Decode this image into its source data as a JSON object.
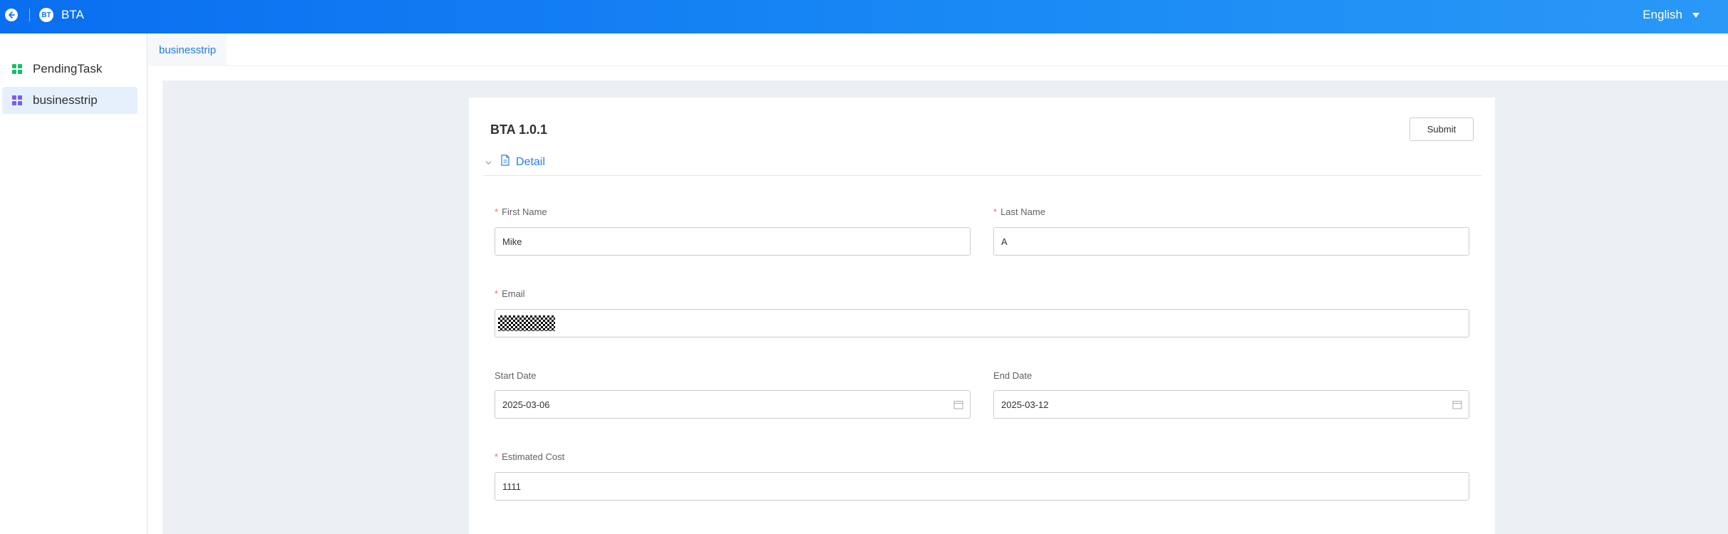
{
  "header": {
    "app_title": "BTA",
    "logo_text": "BT",
    "language": "English",
    "accent": "#1677ee"
  },
  "sidebar": {
    "items": [
      {
        "label": "PendingTask",
        "icon": "grid-icon",
        "icon_color": "#19be6b"
      },
      {
        "label": "businesstrip",
        "icon": "grid-icon",
        "icon_color": "#7b5cf0"
      }
    ]
  },
  "tabs": [
    {
      "label": "businesstrip"
    }
  ],
  "form": {
    "title": "BTA 1.0.1",
    "submit_label": "Submit",
    "section_title": "Detail",
    "fields": {
      "first_name": {
        "label": "First Name",
        "value": "Mike",
        "required": "*"
      },
      "last_name": {
        "label": "Last Name",
        "value": "A",
        "required": "*"
      },
      "email": {
        "label": "Email",
        "value": "",
        "required": "*"
      },
      "start_date": {
        "label": "Start Date",
        "value": "2025-03-06"
      },
      "end_date": {
        "label": "End Date",
        "value": "2025-03-12"
      },
      "estimated_cost": {
        "label": "Estimated Cost",
        "value": "1111",
        "required": "*"
      }
    }
  }
}
